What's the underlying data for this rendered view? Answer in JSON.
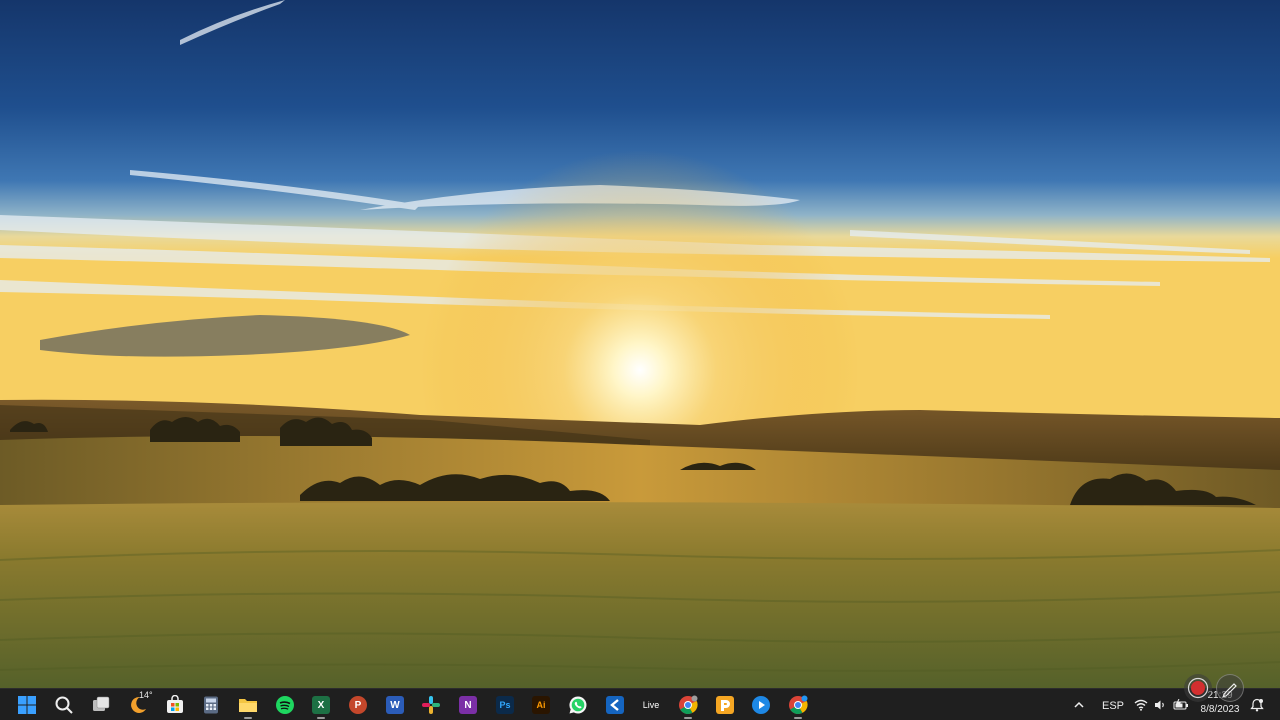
{
  "desktop": {
    "wallpaper": "sunset-landscape"
  },
  "taskbar": {
    "weather": {
      "temp": "14°"
    },
    "apps": [
      {
        "name": "Excel",
        "letter": "X",
        "color": "#1d7044"
      },
      {
        "name": "PowerPoint",
        "letter": "P",
        "color": "#c4472b"
      },
      {
        "name": "Word",
        "letter": "W",
        "color": "#2b5cb8"
      },
      {
        "name": "OneNote",
        "letter": "N",
        "color": "#7b2fa6"
      },
      {
        "name": "Photoshop",
        "letter": "Ps",
        "color": "#0b2a4a",
        "fg": "#31a8ff"
      },
      {
        "name": "Illustrator",
        "letter": "Ai",
        "color": "#2a1500",
        "fg": "#ff9a00"
      }
    ],
    "live_label": "Live",
    "colors": {
      "bg": "#1f1f1f",
      "accent": "#0a84ff"
    }
  },
  "tray": {
    "language": "ESP",
    "time": "21:29",
    "date": "8/8/2023"
  }
}
